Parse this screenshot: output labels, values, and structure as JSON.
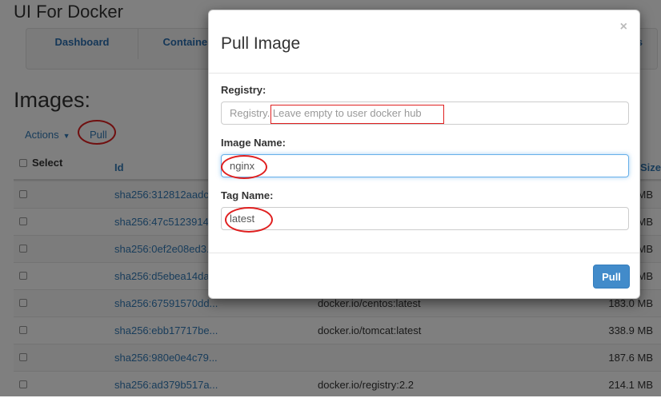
{
  "app": {
    "title": "UI For Docker"
  },
  "nav": {
    "items": [
      {
        "label": "Dashboard"
      },
      {
        "label": "Containers"
      },
      {
        "label": "s"
      }
    ]
  },
  "page": {
    "heading": "Images:",
    "actions_label": "Actions",
    "pull_link": "Pull"
  },
  "table": {
    "headers": {
      "select": "Select",
      "id": "Id",
      "size": "VirtualSize"
    },
    "rows": [
      {
        "id": "sha256:312812aadc...",
        "tag": "",
        "size": "MB"
      },
      {
        "id": "sha256:47c5123914...",
        "tag": "",
        "size": "MB"
      },
      {
        "id": "sha256:0ef2e08ed3...",
        "tag": "",
        "size": "MB"
      },
      {
        "id": "sha256:d5ebea14da...",
        "tag": "",
        "size": "MB"
      },
      {
        "id": "sha256:67591570dd...",
        "tag": "docker.io/centos:latest",
        "size": "183.0 MB"
      },
      {
        "id": "sha256:ebb17717be...",
        "tag": "docker.io/tomcat:latest",
        "size": "338.9 MB"
      },
      {
        "id": "sha256:980e0e4c79...",
        "tag": "",
        "size": "187.6 MB"
      },
      {
        "id": "sha256:ad379b517a...",
        "tag": "docker.io/registry:2.2",
        "size": "214.1 MB"
      }
    ]
  },
  "modal": {
    "title": "Pull Image",
    "close_symbol": "×",
    "registry": {
      "label": "Registry:",
      "placeholder": "Registry. Leave empty to user docker hub",
      "value": ""
    },
    "image": {
      "label": "Image Name:",
      "value": "nginx"
    },
    "tag": {
      "label": "Tag Name:",
      "value": "latest"
    },
    "submit_label": "Pull"
  },
  "colors": {
    "link": "#337ab7",
    "primary_button": "#428bca",
    "annotation": "#e02020"
  }
}
